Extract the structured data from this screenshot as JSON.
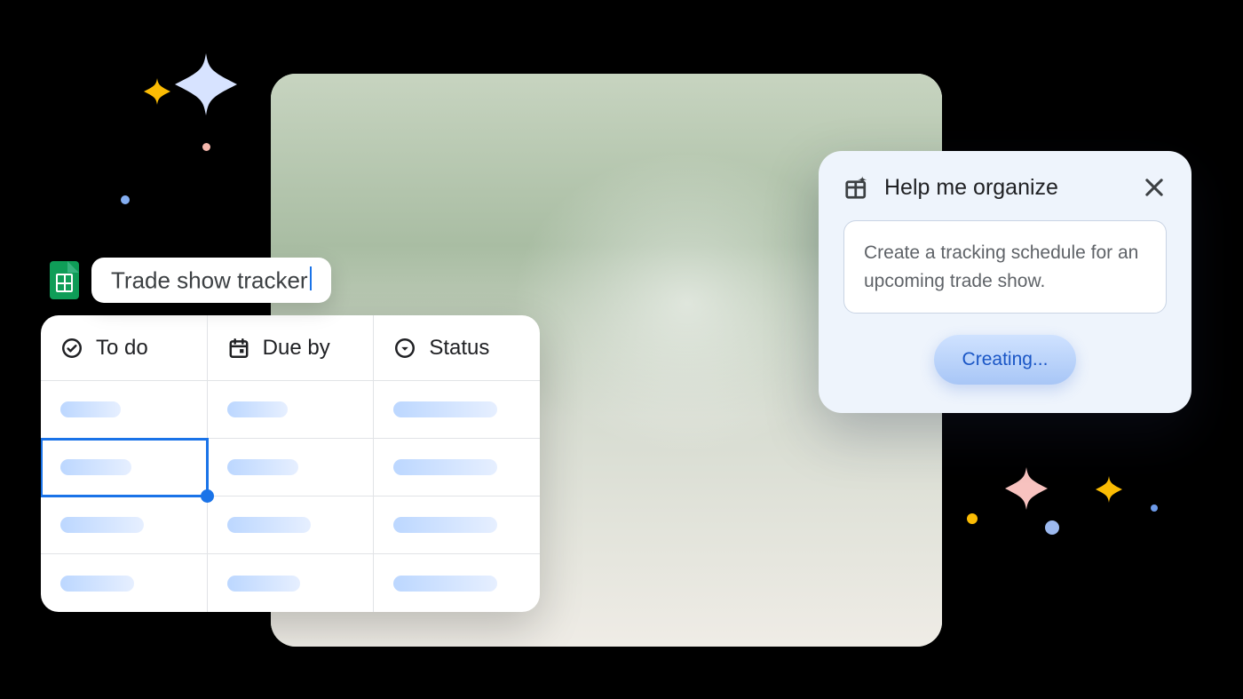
{
  "document": {
    "app": "google-sheets",
    "title": "Trade show tracker"
  },
  "table": {
    "columns": [
      {
        "icon": "check-circle-icon",
        "label": "To do"
      },
      {
        "icon": "calendar-icon",
        "label": "Due by"
      },
      {
        "icon": "status-icon",
        "label": "Status"
      }
    ],
    "body_rows": 4,
    "selected": {
      "row": 1,
      "col": 0
    }
  },
  "panel": {
    "title": "Help me organize",
    "prompt": "Create a tracking schedule for an upcoming trade show.",
    "button": "Creating..."
  },
  "colors": {
    "sheets_green": "#0f9d58",
    "blue": "#1a73e8",
    "panel_bg": "#eef4fc"
  }
}
